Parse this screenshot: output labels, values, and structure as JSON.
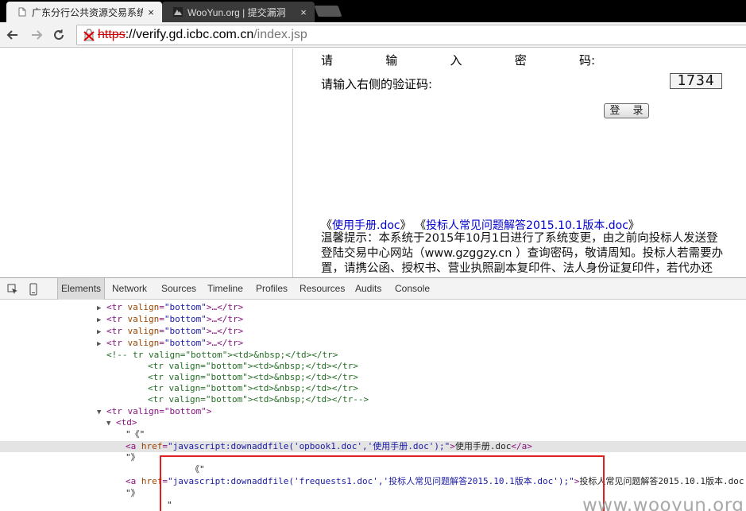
{
  "browser": {
    "tabs": [
      {
        "title": "广东分行公共资源交易系统",
        "close": "×",
        "active": true
      },
      {
        "title": "WooYun.org | 提交漏洞",
        "close": "×",
        "active": false
      }
    ],
    "url": {
      "scheme": "https",
      "host": "://verify.gd.icbc.com.cn",
      "path": "/index.jsp"
    }
  },
  "page": {
    "password_label": [
      "请",
      "输",
      "入",
      "密",
      "码:"
    ],
    "captcha_label": "请输入右侧的验证码:",
    "captcha_value": "1734",
    "login_button": "登 录",
    "doc_links": {
      "open1": "《",
      "manual": "使用手册.doc",
      "close1": "》",
      "open2": "《",
      "faq": "投标人常见问题解答2015.10.1版本.doc",
      "close2": "》"
    },
    "notice_lines": [
      "温馨提示：本系统于2015年10月1日进行了系统变更，由之前向投标人发送登",
      "登陆交易中心网站（www.gzggzy.cn ）查询密码，敬请周知。投标人若需要办",
      "置，请携公函、授权书、营业执照副本复印件、法人身份证复印件，若代办还"
    ]
  },
  "devtools": {
    "tabs": [
      "Elements",
      "Network",
      "Sources",
      "Timeline",
      "Profiles",
      "Resources",
      "Audits",
      "Console"
    ],
    "active_tab": "Elements",
    "collapsed_tr": {
      "tag_open": "<tr ",
      "attr": "valign",
      "eq": "=",
      "value": "\"bottom\"",
      "tail": ">…</tr>"
    },
    "comment_lines": [
      "<!-- tr valign=\"bottom\"><td>&nbsp;</td></tr>",
      "<tr valign=\"bottom\"><td>&nbsp;</td></tr>",
      "<tr valign=\"bottom\"><td>&nbsp;</td></tr>",
      "<tr valign=\"bottom\"><td>&nbsp;</td></tr>",
      "<tr valign=\"bottom\"><td>&nbsp;</td></tr-->"
    ],
    "expanded_tr": "<tr valign=\"bottom\">",
    "td": "<td>",
    "text1": "\"《\"",
    "link1": {
      "open": "<a ",
      "attr": "href",
      "value": "\"javascript:downaddfile('opbook1.doc','使用手册.doc');\"",
      "text": "使用手册.doc",
      "close": "</a>"
    },
    "text2": "\"》",
    "text3": "《\"",
    "link2": {
      "open": "<a ",
      "attr": "href",
      "value": "\"javascript:downaddfile('frequests1.doc','投标人常见问题解答2015.10.1版本.doc');\"",
      "text": "投标人常见问题解答2015.10.1版本.doc"
    },
    "text4": "\"》",
    "text5": "\""
  },
  "watermark": "www.wooyun.org",
  "colors": {
    "annotation_box": "#e02020",
    "link": "#0000cc"
  }
}
